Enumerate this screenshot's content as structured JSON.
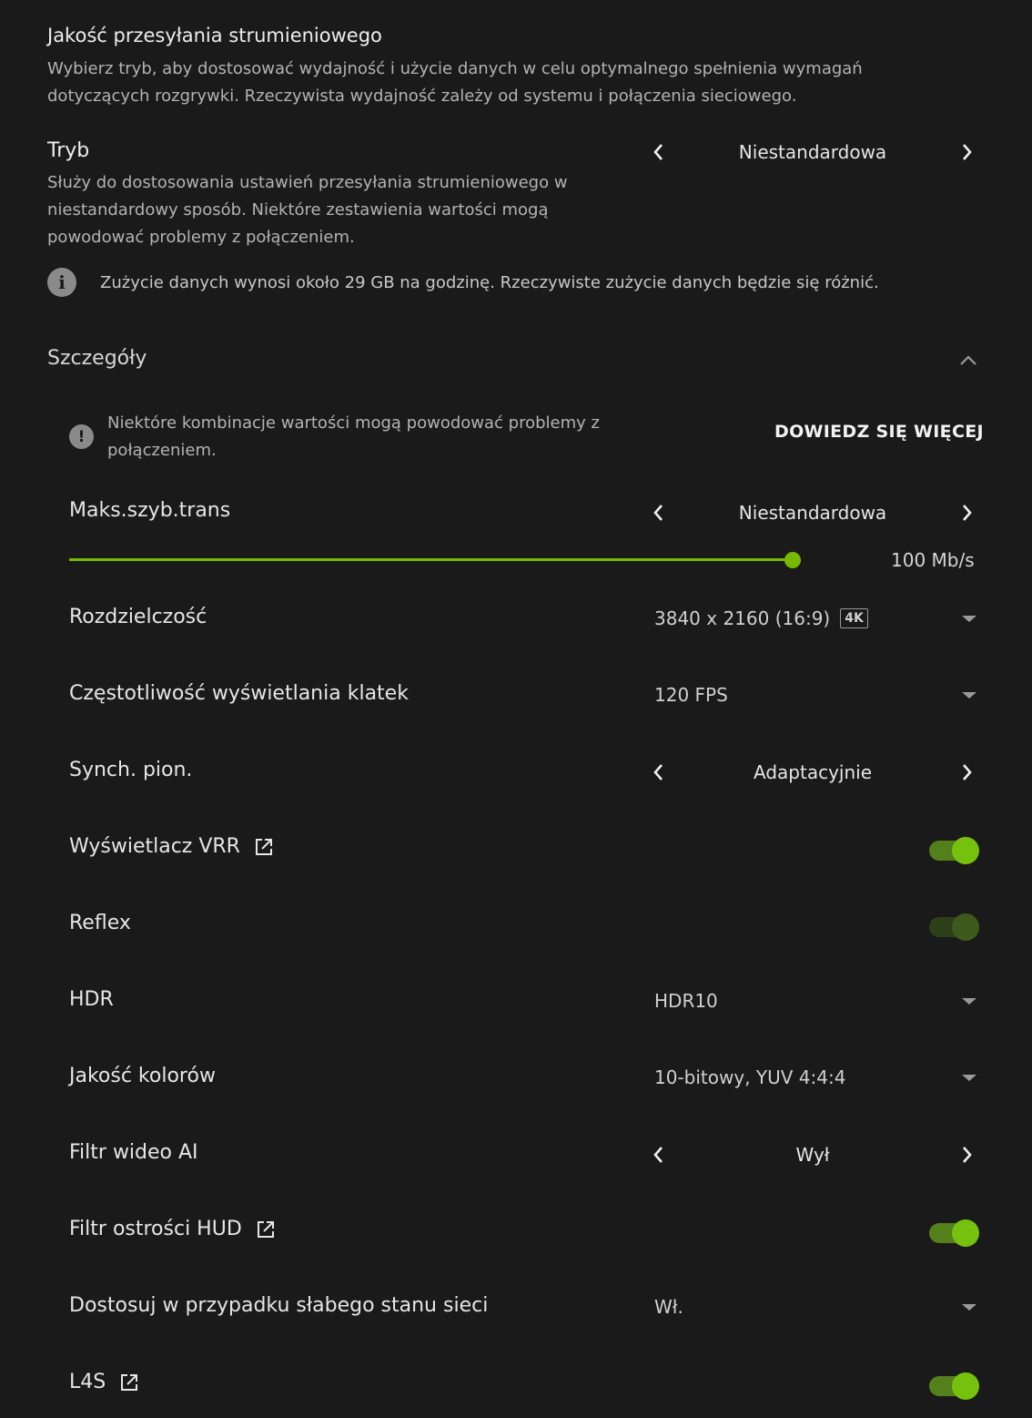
{
  "header": {
    "title": "Jakość przesyłania strumieniowego",
    "description": "Wybierz tryb, aby dostosować wydajność i użycie danych w celu optymalnego spełnienia wymagań dotyczących rozgrywki. Rzeczywista wydajność zależy od systemu i połączenia sieciowego."
  },
  "mode": {
    "title": "Tryb",
    "description": "Służy do dostosowania ustawień przesyłania strumieniowego w niestandardowy sposób. Niektóre zestawienia wartości mogą powodować problemy z połączeniem.",
    "value": "Niestandardowa"
  },
  "data_usage": {
    "icon": "info-icon",
    "text": "Zużycie danych wynosi około 29 GB na godzinę. Rzeczywiste zużycie danych będzie się różnić."
  },
  "details": {
    "title": "Szczegóły",
    "expanded": true,
    "warning_icon": "alert-icon",
    "warning_text": "Niektóre kombinacje wartości mogą powodować problemy z połączeniem.",
    "learn_more": "DOWIEDZ SIĘ WIĘCEJ"
  },
  "settings": {
    "bitrate": {
      "label": "Maks.szyb.trans",
      "value": "Niestandardowa",
      "slider_value": "100 Mb/s",
      "slider_fraction": 1.0
    },
    "resolution": {
      "label": "Rozdzielczość",
      "value": "3840 x 2160 (16:9)",
      "badge": "4K"
    },
    "framerate": {
      "label": "Częstotliwość wyświetlania klatek",
      "value": "120 FPS"
    },
    "vsync": {
      "label": "Synch. pion.",
      "value": "Adaptacyjnie"
    },
    "vrr": {
      "label": "Wyświetlacz VRR",
      "on": true
    },
    "reflex": {
      "label": "Reflex",
      "on": true,
      "disabled": true
    },
    "hdr": {
      "label": "HDR",
      "value": "HDR10"
    },
    "color": {
      "label": "Jakość kolorów",
      "value": "10-bitowy, YUV 4:4:4"
    },
    "ai_filter": {
      "label": "Filtr wideo AI",
      "value": "Wył"
    },
    "hud_filter": {
      "label": "Filtr ostrości HUD",
      "on": true
    },
    "poor_network": {
      "label": "Dostosuj w przypadku słabego stanu sieci",
      "value": "Wł."
    },
    "l4s": {
      "label": "L4S",
      "on": true
    }
  },
  "colors": {
    "accent": "#76b900",
    "background": "#1a1a1a"
  }
}
